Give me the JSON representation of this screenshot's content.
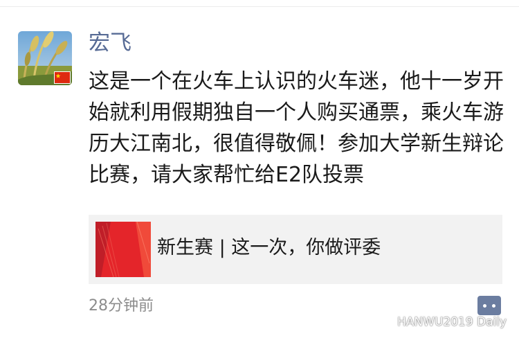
{
  "post": {
    "author": "宏飞",
    "content": "这是一个在火车上认识的火车迷，他十一岁开始就利用假期独自一个人购买通票，乘火车游历大江南北，很值得敬佩！参加大学新生辩论比赛，请大家帮忙给E2队投票",
    "link_card": {
      "title": "新生赛 | 这一次，你做评委"
    },
    "time": "28分钟前"
  },
  "watermark": {
    "text": "HANWU2019 Daily"
  },
  "icons": {
    "avatar": "wheat-field-avatar",
    "flag": "china-flag-icon",
    "comment": "comment-more-icon",
    "watermark": "wechat-icon"
  },
  "colors": {
    "author_name": "#576b95",
    "content_text": "#1a1a1a",
    "card_background": "#f2f2f2",
    "time_text": "#8c8c8c",
    "comment_button": "#5b6f96"
  }
}
